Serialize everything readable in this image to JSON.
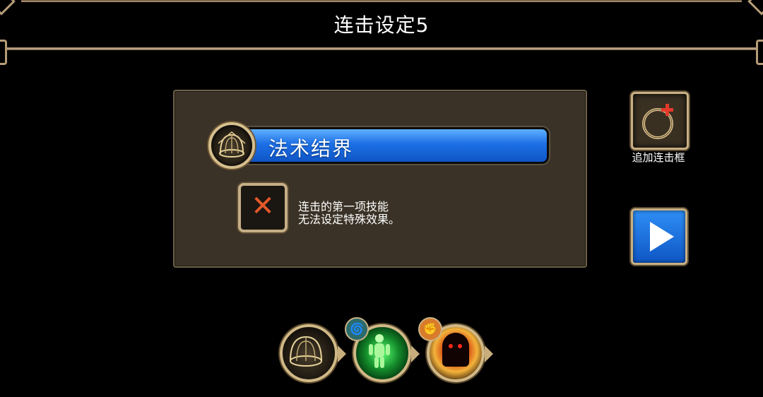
{
  "header": {
    "title": "连击设定5"
  },
  "panel": {
    "skill_name": "法术结界",
    "skill_icon": "barrier-dome-icon",
    "blocked_icon": "cross-icon",
    "message_line1": "连击的第一项技能",
    "message_line2": "无法设定特殊效果。"
  },
  "side": {
    "add_icon": "ring-plus-icon",
    "add_label": "追加连击框",
    "play_icon": "play-icon"
  },
  "combo": {
    "slots": [
      {
        "icon": "barrier-dome-icon"
      },
      {
        "icon": "green-aura-figure-icon",
        "badge_icon": "swirl-badge-icon"
      },
      {
        "icon": "fire-shadow-icon",
        "badge_icon": "fist-badge-icon"
      }
    ]
  },
  "colors": {
    "accent_blue": "#1d6fe5",
    "gold_border": "#c9b084",
    "panel_bg": "#3a3226"
  }
}
